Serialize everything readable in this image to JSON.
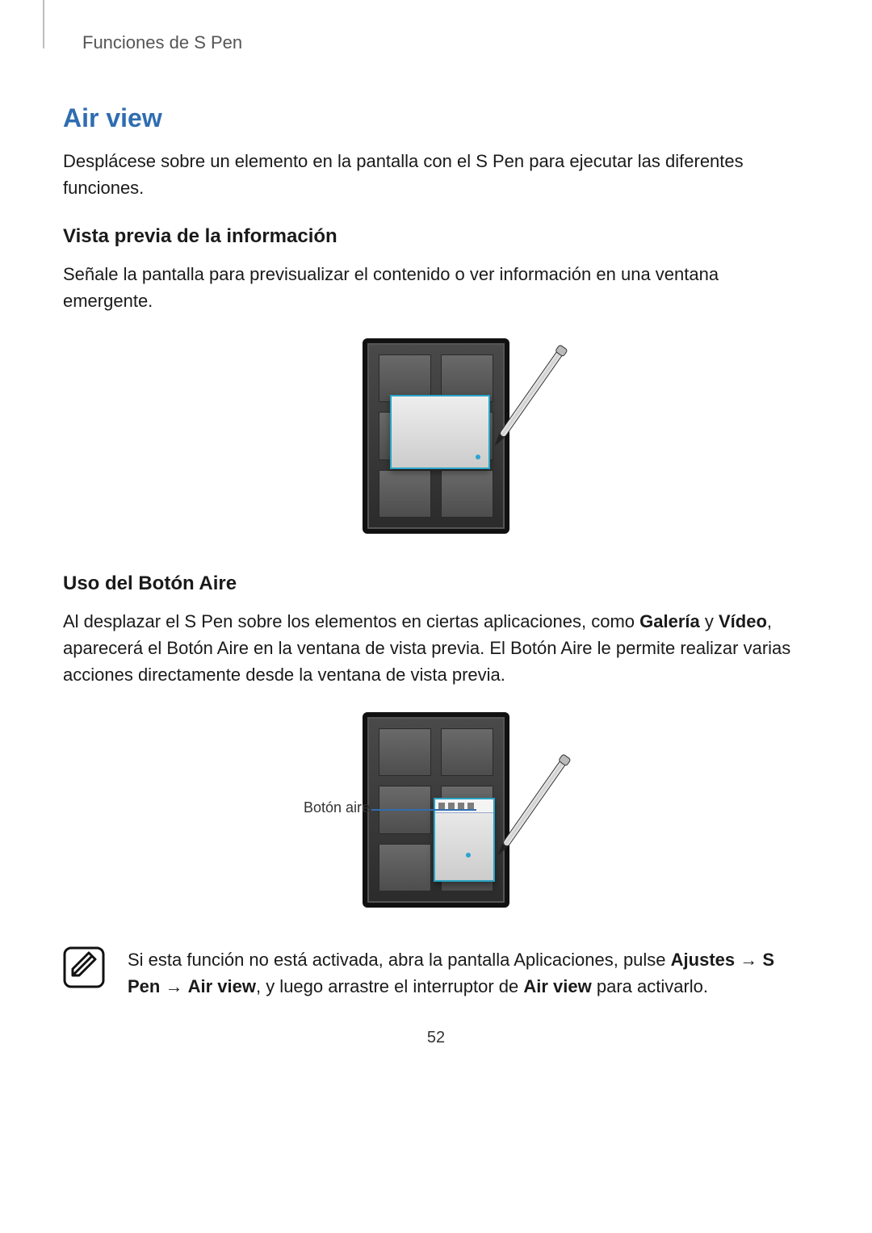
{
  "breadcrumb": "Funciones de S Pen",
  "section": {
    "title": "Air view",
    "intro": "Desplácese sobre un elemento en la pantalla con el S Pen para ejecutar las diferentes funciones."
  },
  "sub1": {
    "title": "Vista previa de la información",
    "body": "Señale la pantalla para previsualizar el contenido o ver información en una ventana emergente."
  },
  "sub2": {
    "title": "Uso del Botón Aire",
    "body_p1": "Al desplazar el S Pen sobre los elementos en ciertas aplicaciones, como ",
    "body_b1": "Galería",
    "body_p2": " y ",
    "body_b2": "Vídeo",
    "body_p3": ", aparecerá el Botón Aire en la ventana de vista previa. El Botón Aire le permite realizar varias acciones directamente desde la ventana de vista previa.",
    "callout": "Botón aire"
  },
  "note": {
    "p1": "Si esta función no está activada, abra la pantalla Aplicaciones, pulse ",
    "b1": "Ajustes",
    "arrow": " → ",
    "b2": "S Pen",
    "b3": "Air view",
    "p2": ", y luego arrastre el interruptor de ",
    "b4": "Air view",
    "p3": " para activarlo."
  },
  "page_number": "52"
}
